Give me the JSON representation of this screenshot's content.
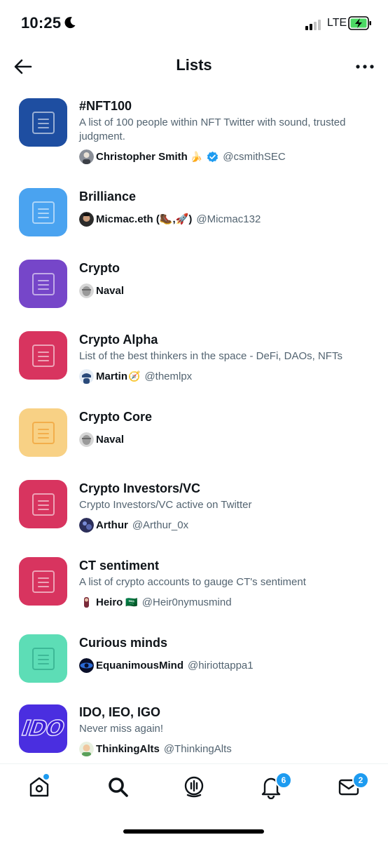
{
  "status": {
    "time": "10:25",
    "network": "LTE",
    "icons": [
      "moon-icon",
      "signal-icon",
      "battery-charging-icon"
    ]
  },
  "header": {
    "title": "Lists",
    "back_icon": "arrow-left-icon",
    "more_icon": "more-horizontal-icon"
  },
  "colors": {
    "accent": "#1d9bf0",
    "text": "#0f1419",
    "secondary": "#536471"
  },
  "lists": [
    {
      "name": "#NFT100",
      "description": "A list of 100 people within NFT Twitter with sound, trusted judgment.",
      "owner": "Christopher Smith",
      "owner_emoji": "🍌",
      "verified": true,
      "handle": "@csmithSEC",
      "color": "#1e4ea1"
    },
    {
      "name": "Brilliance",
      "description": "",
      "owner": "Micmac.eth (🥾,🚀)",
      "owner_emoji": "",
      "verified": false,
      "handle": "@Micmac132",
      "color": "#4aa3f0"
    },
    {
      "name": "Crypto",
      "description": "",
      "owner": "Naval",
      "owner_emoji": "",
      "verified": false,
      "handle": "",
      "color": "#7646c9"
    },
    {
      "name": "Crypto Alpha",
      "description": "List of the best thinkers in the space - DeFi, DAOs, NFTs",
      "owner": "Martin",
      "owner_emoji": "🧭",
      "verified": false,
      "handle": "@themlpx",
      "color": "#d8345f"
    },
    {
      "name": "Crypto Core",
      "description": "",
      "owner": "Naval",
      "owner_emoji": "",
      "verified": false,
      "handle": "",
      "color": "#f8d185"
    },
    {
      "name": "Crypto Investors/VC",
      "description": "Crypto Investors/VC active on Twitter",
      "owner": "Arthur",
      "owner_emoji": "",
      "verified": false,
      "handle": "@Arthur_0x",
      "color": "#d8345f"
    },
    {
      "name": "CT sentiment",
      "description": "A list of crypto accounts to gauge CT's sentiment",
      "owner": "Heiro",
      "owner_emoji": "🇸🇦",
      "verified": false,
      "handle": "@Heir0nymusmind",
      "color": "#d8345f"
    },
    {
      "name": "Curious minds",
      "description": "",
      "owner": "EquanimousMind",
      "owner_emoji": "",
      "verified": false,
      "handle": "@hiriottappa1",
      "color": "#5dddb6"
    },
    {
      "name": "IDO, IEO, IGO",
      "description": "Never miss again!",
      "owner": "ThinkingAlts",
      "owner_emoji": "",
      "verified": false,
      "handle": "@ThinkingAlts",
      "color": "#4a2ee0",
      "logo_text": "IDO"
    }
  ],
  "tabs": [
    {
      "name": "tab-home",
      "icon": "home-icon",
      "badge": ""
    },
    {
      "name": "tab-search",
      "icon": "search-icon",
      "badge": ""
    },
    {
      "name": "tab-spaces",
      "icon": "spaces-icon",
      "badge": ""
    },
    {
      "name": "tab-notifications",
      "icon": "bell-icon",
      "badge": "6"
    },
    {
      "name": "tab-messages",
      "icon": "mail-icon",
      "badge": "2"
    }
  ]
}
